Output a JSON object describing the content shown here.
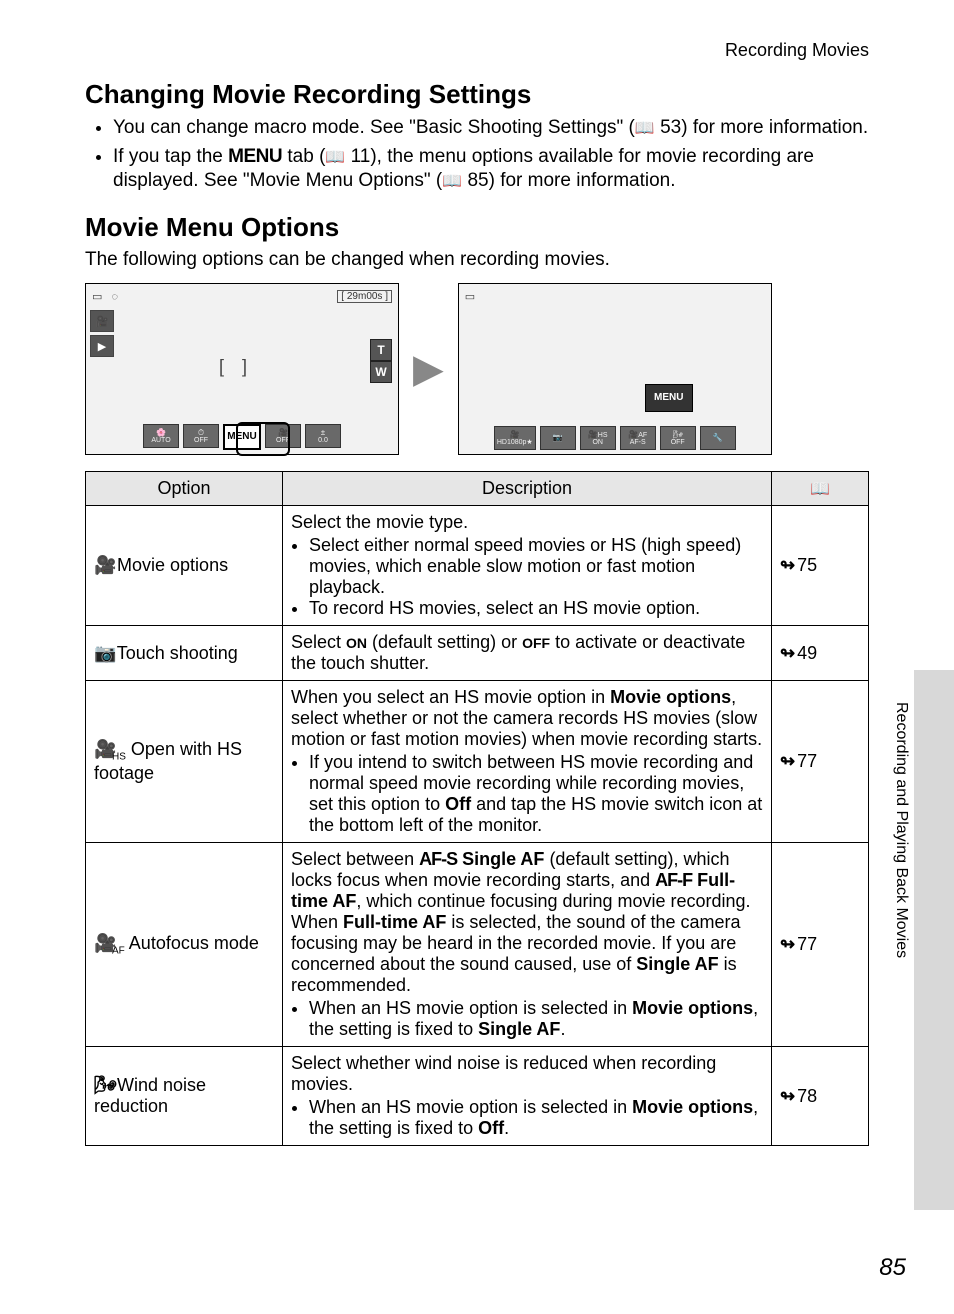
{
  "header": {
    "breadcrumb": "Recording Movies"
  },
  "section1": {
    "title": "Changing Movie Recording Settings",
    "bullet1a": "You can change macro mode. See \"Basic Shooting Settings\" (",
    "bullet1_ref": "53",
    "bullet1b": ") for more information.",
    "bullet2a": "If you tap the ",
    "bullet2_menu": "MENU",
    "bullet2b": " tab (",
    "bullet2_ref": "11",
    "bullet2c": "), the menu options available for movie recording are displayed. See \"Movie Menu Options\" (",
    "bullet2_ref2": "85",
    "bullet2d": ") for more information."
  },
  "section2": {
    "title": "Movie Menu Options",
    "intro": "The following options can be changed when recording movies."
  },
  "shot1": {
    "time": "29m00s",
    "icons": {
      "auto": "AUTO",
      "off": "OFF",
      "menu": "MENU",
      "off2": "OFF",
      "exp": "0.0"
    },
    "t": "T",
    "w": "W"
  },
  "shot2": {
    "menu": "MENU",
    "b1": "HD1080p★",
    "b2": "",
    "b3": "ON",
    "b4": "AF-S",
    "b5": "OFF",
    "hs": "HS",
    "af": "AF"
  },
  "table": {
    "h1": "Option",
    "h2": "Description",
    "h3": "",
    "rows": [
      {
        "icon": "🎥",
        "name": "Movie options",
        "desc_lead": "Select the movie type.",
        "bullets": [
          "Select either normal speed movies or HS (high speed) movies, which enable slow motion or fast motion playback.",
          "To record HS movies, select an HS movie option."
        ],
        "ref": "75"
      },
      {
        "icon": "📷",
        "name": "Touch shooting",
        "on": "ON",
        "off": "OFF",
        "desc_a": "Select ",
        "desc_b": " (default setting) or ",
        "desc_c": " to activate or deactivate the touch shutter.",
        "ref": "49"
      },
      {
        "icon": "🎥",
        "name": "Open with HS footage",
        "desc_a": "When you select an HS movie option in ",
        "bold1": "Movie options",
        "desc_b": ", select whether or not the camera records HS movies (slow motion or fast motion movies) when movie recording starts.",
        "bullet_a": "If you intend to switch between HS movie recording and normal speed movie recording while recording movies, set this option to ",
        "bold2": "Off",
        "bullet_b": " and tap the HS movie switch icon at the bottom left of the monitor.",
        "ref": "77"
      },
      {
        "icon": "🎥",
        "name": "Autofocus mode",
        "p1a": "Select between ",
        "afs": "AF-S",
        "p1b": " Single AF",
        "p1c": " (default setting), which locks focus when movie recording starts, and ",
        "aff": "AF-F",
        "p1d": " Full-time AF",
        "p1e": ", which continue focusing during movie recording.",
        "p2a": "When ",
        "p2bold": "Full-time AF",
        "p2b": " is selected, the sound of the camera focusing may be heard in the recorded movie. If you are concerned about the sound caused, use of ",
        "p2bold2": "Single AF",
        "p2c": " is recommended.",
        "bul_a": "When an HS movie option is selected in ",
        "bul_bold": "Movie options",
        "bul_b": ", the setting is fixed to ",
        "bul_bold2": "Single AF",
        "bul_c": ".",
        "ref": "77"
      },
      {
        "icon": "🌬",
        "name": "Wind noise reduction",
        "desc": "Select whether wind noise is reduced when recording movies.",
        "bul_a": "When an HS movie option is selected in ",
        "bul_bold": "Movie options",
        "bul_b": ", the setting is fixed to ",
        "bul_bold2": "Off",
        "bul_c": ".",
        "ref": "78"
      }
    ]
  },
  "sidetab": "Recording and Playing Back Movies",
  "pagenum": "85"
}
